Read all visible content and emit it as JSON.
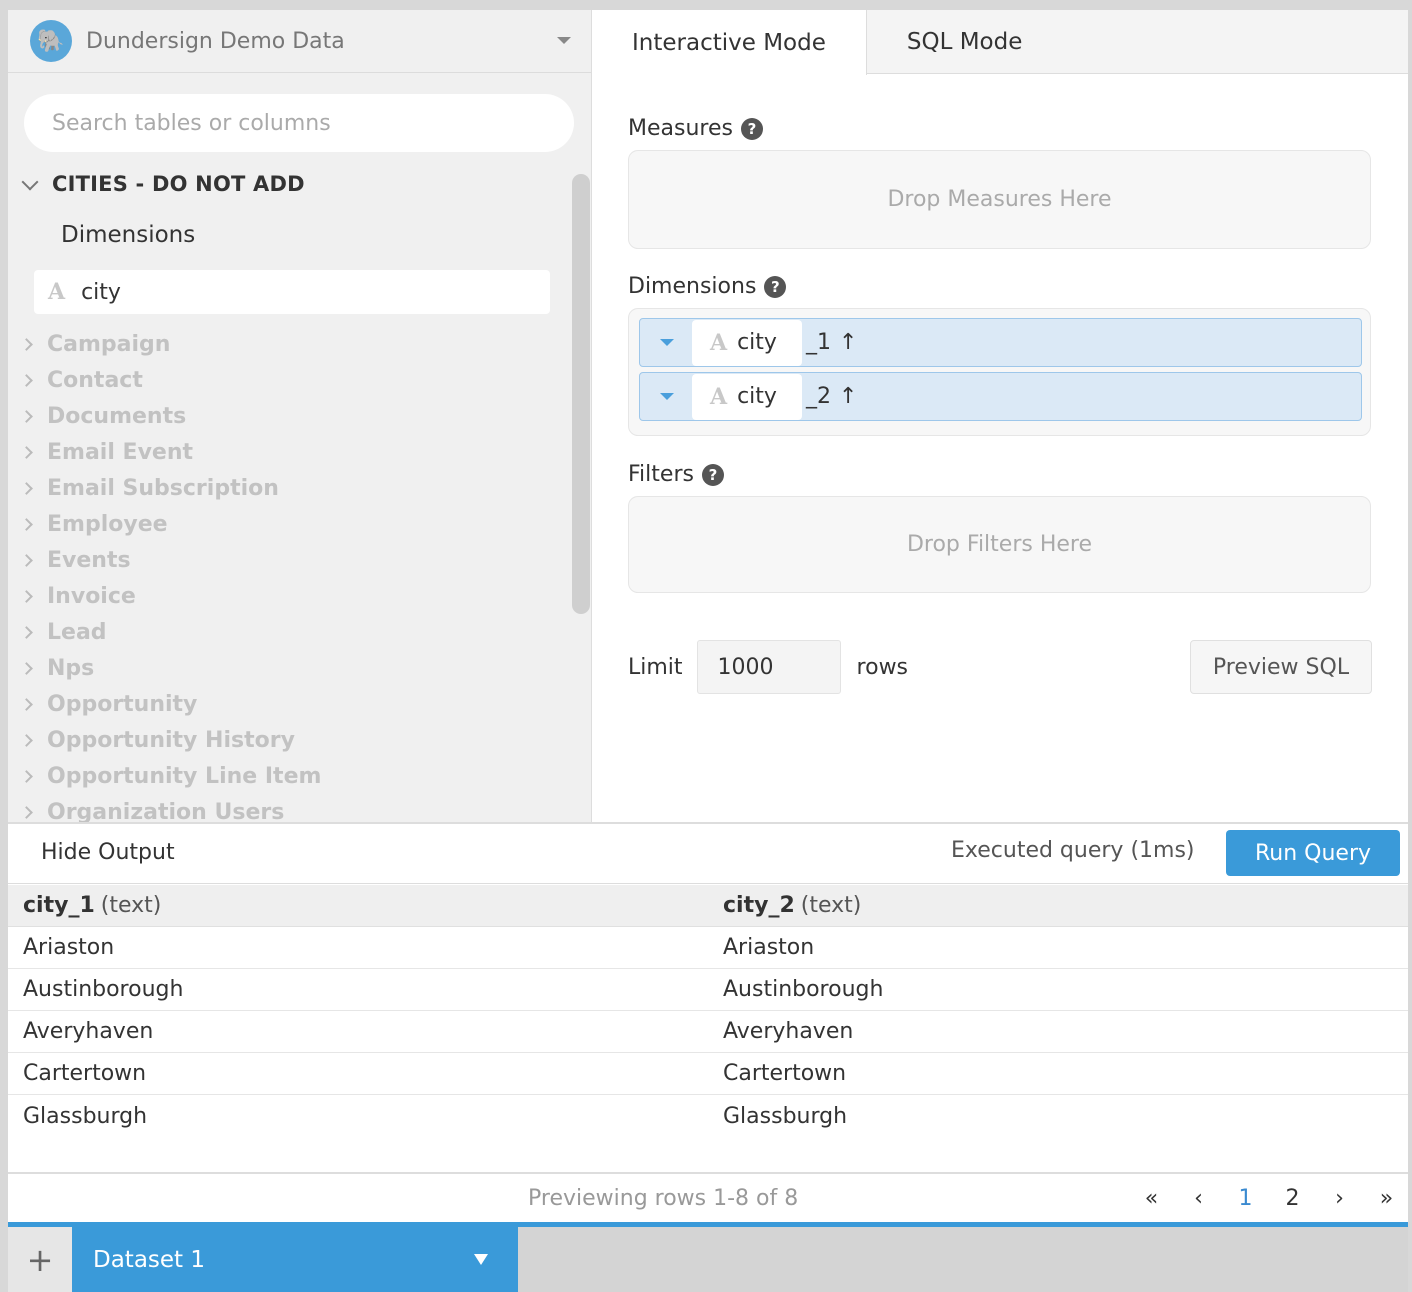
{
  "datasource": {
    "name": "Dundersign Demo Data",
    "icon": "postgres-elephant-icon"
  },
  "search": {
    "placeholder": "Search tables or columns"
  },
  "tree": {
    "group_title": "CITIES - DO NOT ADD",
    "dimensions_header": "Dimensions",
    "field": "city",
    "tables": [
      "Campaign",
      "Contact",
      "Documents",
      "Email Event",
      "Email Subscription",
      "Employee",
      "Events",
      "Invoice",
      "Lead",
      "Nps",
      "Opportunity",
      "Opportunity History",
      "Opportunity Line Item",
      "Organization Users"
    ]
  },
  "tabs": {
    "interactive": "Interactive Mode",
    "sql": "SQL Mode"
  },
  "measures": {
    "label": "Measures",
    "drop_text": "Drop Measures Here"
  },
  "dimensions": {
    "label": "Dimensions",
    "items": [
      {
        "field": "city",
        "suffix": "_1",
        "sort": "↑"
      },
      {
        "field": "city",
        "suffix": "_2",
        "sort": "↑"
      }
    ]
  },
  "filters": {
    "label": "Filters",
    "drop_text": "Drop Filters Here"
  },
  "limit": {
    "label": "Limit",
    "value": "1000",
    "unit": "rows"
  },
  "preview_sql": "Preview SQL",
  "output": {
    "hide_label": "Hide Output",
    "executed": "Executed query (1ms)",
    "run_label": "Run Query",
    "columns": [
      {
        "name": "city_1",
        "type": "(text)"
      },
      {
        "name": "city_2",
        "type": "(text)"
      }
    ],
    "rows": [
      [
        "Ariaston",
        "Ariaston"
      ],
      [
        "Austinborough",
        "Austinborough"
      ],
      [
        "Averyhaven",
        "Averyhaven"
      ],
      [
        "Cartertown",
        "Cartertown"
      ],
      [
        "Glassburgh",
        "Glassburgh"
      ]
    ],
    "previewing": "Previewing rows 1-8 of 8",
    "pager": {
      "first": "«",
      "prev": "‹",
      "pages": [
        "1",
        "2"
      ],
      "current": "1",
      "next": "›",
      "last": "»"
    }
  },
  "bottom": {
    "add": "+",
    "dataset_tab": "Dataset 1"
  },
  "colors": {
    "accent": "#3a9ad9",
    "dim_row_bg": "#dbe9f6"
  }
}
